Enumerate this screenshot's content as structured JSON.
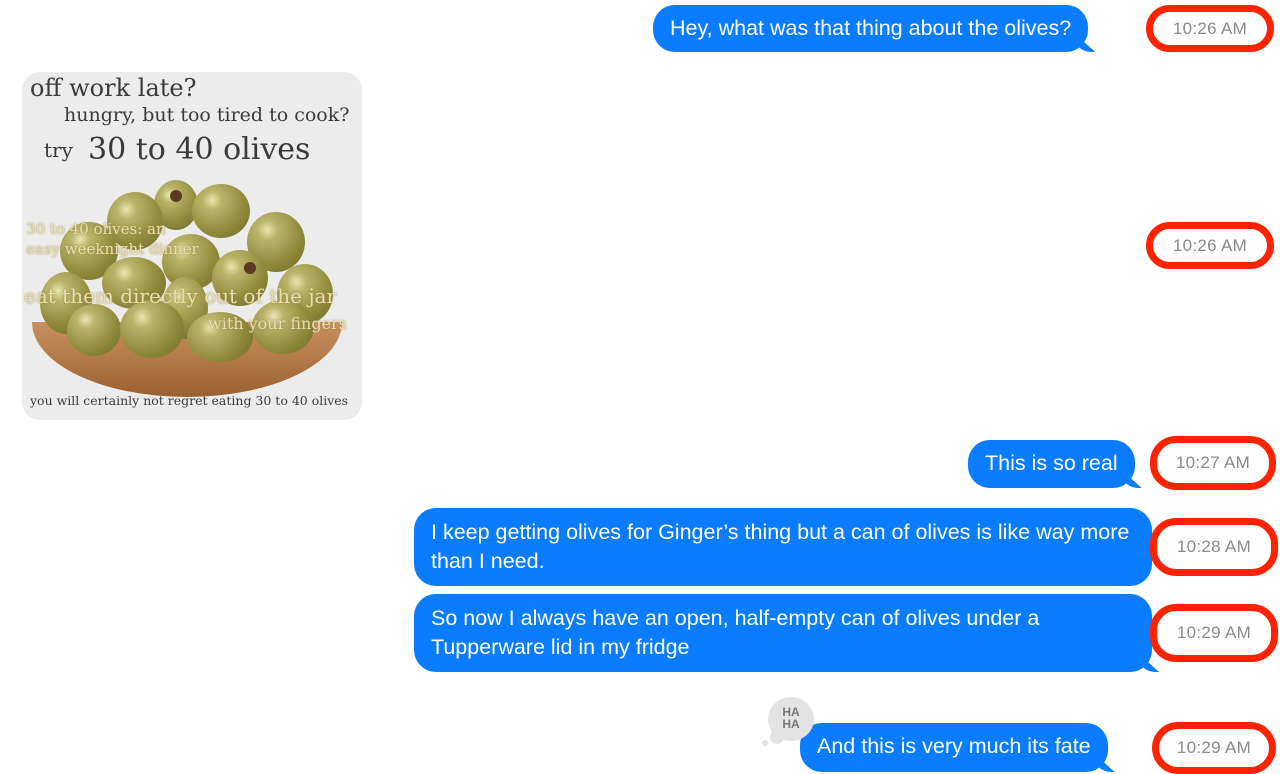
{
  "colors": {
    "sent_bubble": "#0a7cff",
    "highlight_ring": "#ff2200",
    "timestamp": "#8a8a8a"
  },
  "messages": [
    {
      "text": "Hey, what was that thing about the olives?",
      "time": "10:26 AM"
    },
    {
      "type": "image",
      "time": "10:26 AM",
      "image_text": {
        "line1": "off work late?",
        "line2": "hungry, but too tired to cook?",
        "line3a": "try",
        "line3b": "30 to 40 olives",
        "line4": "30 to 40 olives: an",
        "line5": "easy weeknight dinner",
        "line6": "eat them directly out of the jar",
        "line7": "with your fingers",
        "line8": "you will certainly not regret eating 30 to 40 olives"
      }
    },
    {
      "text": "This is so real",
      "time": "10:27 AM"
    },
    {
      "text": "I keep getting olives for Ginger’s thing but a can of olives is like way more than I need.",
      "time": "10:28 AM"
    },
    {
      "text": "So now I always have an open, half-empty can of olives under a Tupperware lid in my fridge",
      "time": "10:29 AM"
    },
    {
      "text": "And this is very much its fate",
      "time": "10:29 AM",
      "reaction": {
        "icon": "haha-tapback-icon",
        "line1": "HA",
        "line2": "HA"
      }
    }
  ]
}
